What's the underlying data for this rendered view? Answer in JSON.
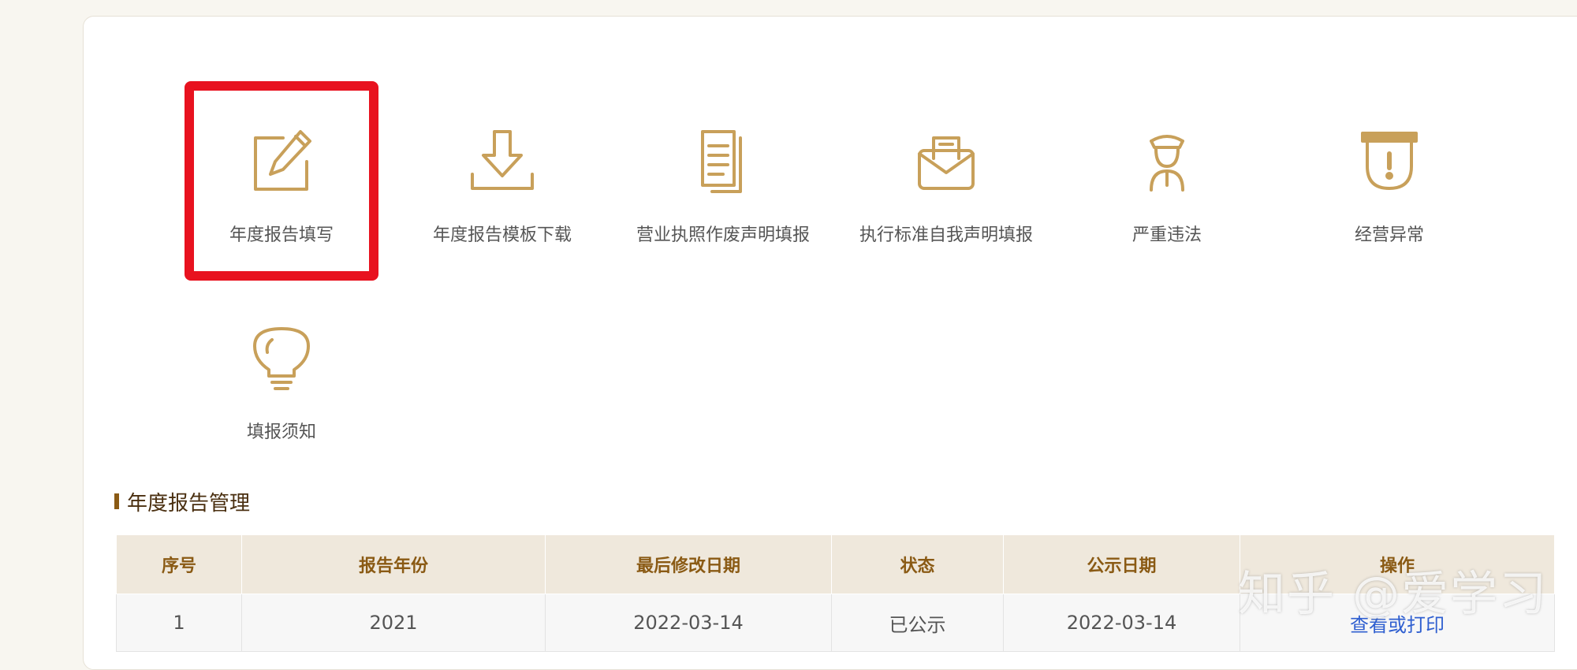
{
  "colors": {
    "accent": "#c8a05a",
    "title_text": "#4a2f10",
    "header_text": "#8a5a14",
    "link": "#2f5fd0",
    "highlight": "#e8121f"
  },
  "tiles": [
    {
      "label": "年度报告填写",
      "icon": "edit-pencil-icon"
    },
    {
      "label": "年度报告模板下载",
      "icon": "download-icon"
    },
    {
      "label": "营业执照作废声明填报",
      "icon": "document-icon"
    },
    {
      "label": "执行标准自我声明填报",
      "icon": "envelope-icon"
    },
    {
      "label": "严重违法",
      "icon": "officer-icon"
    },
    {
      "label": "经营异常",
      "icon": "warning-shield-icon"
    },
    {
      "label": "填报须知",
      "icon": "lightbulb-icon"
    }
  ],
  "section": {
    "title": "年度报告管理"
  },
  "table": {
    "headers": [
      "序号",
      "报告年份",
      "最后修改日期",
      "状态",
      "公示日期",
      "操作"
    ],
    "rows": [
      [
        "1",
        "2021",
        "2022-03-14",
        "已公示",
        "2022-03-14",
        "查看或打印"
      ]
    ]
  },
  "watermark": "知乎 @爱学习"
}
